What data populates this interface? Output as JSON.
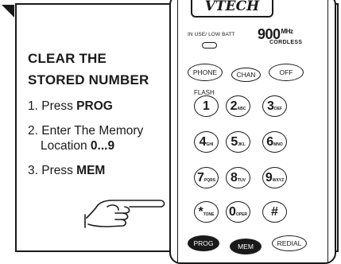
{
  "instructions": {
    "heading_line1": "CLEAR THE",
    "heading_line2": "STORED NUMBER",
    "step1_prefix": "1. Press ",
    "step1_key": "PROG",
    "step2_prefix": "2. Enter The Memory",
    "step2_cont": "Location ",
    "step2_value": "0...9",
    "step3_prefix": "3. Press ",
    "step3_key": "MEM"
  },
  "phone": {
    "brand": "VTECH",
    "in_use_label": "IN USE/ LOW BATT",
    "model": "900",
    "model_unit": "MHz",
    "model_sub": "CORDLESS",
    "buttons": {
      "phone": "PHONE",
      "chan": "CHAN",
      "off": "OFF",
      "flash": "FLASH"
    },
    "keys": [
      {
        "digit": "1",
        "letters": ""
      },
      {
        "digit": "2",
        "letters": "ABC"
      },
      {
        "digit": "3",
        "letters": "DEF"
      },
      {
        "digit": "4",
        "letters": "GHI"
      },
      {
        "digit": "5",
        "letters": "JKL"
      },
      {
        "digit": "6",
        "letters": "MNO"
      },
      {
        "digit": "7",
        "letters": "PQRS"
      },
      {
        "digit": "8",
        "letters": "TUV"
      },
      {
        "digit": "9",
        "letters": "WXYZ"
      },
      {
        "digit": "*",
        "letters": "TONE"
      },
      {
        "digit": "0",
        "letters": "OPER"
      },
      {
        "digit": "#",
        "letters": ""
      }
    ],
    "bottom": {
      "prog": "PROG",
      "mem": "MEM",
      "redial": "REDIAL"
    }
  }
}
